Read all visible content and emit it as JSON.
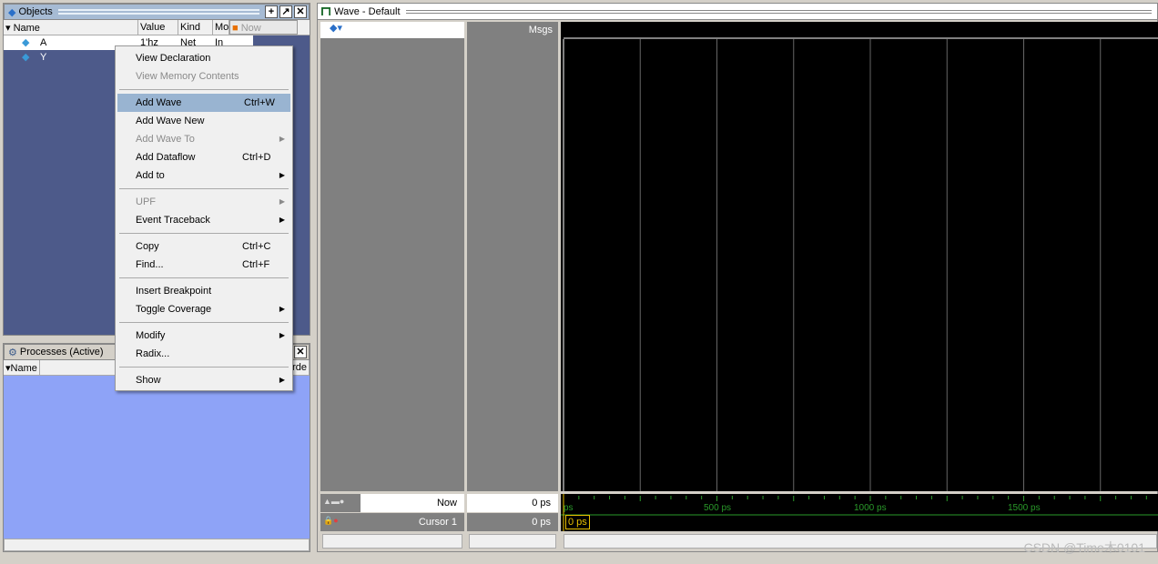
{
  "objects": {
    "title": "Objects",
    "columns": [
      "Name",
      "Value",
      "Kind",
      "Mode"
    ],
    "now_label": "Now",
    "rows": [
      {
        "name": "A",
        "value": "1'hz",
        "kind": "Net",
        "mode": "In"
      },
      {
        "name": "Y",
        "value": "",
        "kind": "",
        "mode": ""
      }
    ]
  },
  "processes": {
    "title": "Processes (Active)",
    "columns": [
      "Name",
      "Orde"
    ]
  },
  "context_menu": [
    {
      "label": "View Declaration",
      "enabled": true
    },
    {
      "label": "View Memory Contents",
      "enabled": false
    },
    {
      "sep": true
    },
    {
      "label": "Add Wave",
      "shortcut": "Ctrl+W",
      "enabled": true,
      "highlighted": true
    },
    {
      "label": "Add Wave New",
      "enabled": true
    },
    {
      "label": "Add Wave To",
      "enabled": false,
      "submenu": true
    },
    {
      "label": "Add Dataflow",
      "shortcut": "Ctrl+D",
      "enabled": true
    },
    {
      "label": "Add to",
      "enabled": true,
      "submenu": true
    },
    {
      "sep": true
    },
    {
      "label": "UPF",
      "enabled": false,
      "submenu": true
    },
    {
      "label": "Event Traceback",
      "enabled": true,
      "submenu": true
    },
    {
      "sep": true
    },
    {
      "label": "Copy",
      "shortcut": "Ctrl+C",
      "enabled": true
    },
    {
      "label": "Find...",
      "shortcut": "Ctrl+F",
      "enabled": true
    },
    {
      "sep": true
    },
    {
      "label": "Insert Breakpoint",
      "enabled": true
    },
    {
      "label": "Toggle Coverage",
      "enabled": true,
      "submenu": true
    },
    {
      "sep": true
    },
    {
      "label": "Modify",
      "enabled": true,
      "submenu": true
    },
    {
      "label": "Radix...",
      "enabled": true
    },
    {
      "sep": true
    },
    {
      "label": "Show",
      "enabled": true,
      "submenu": true
    }
  ],
  "wave": {
    "title": "Wave - Default",
    "msgs_label": "Msgs",
    "now_label": "Now",
    "now_value": "0 ps",
    "cursor_label": "Cursor 1",
    "cursor_value": "0 ps",
    "cursor_time": "0 ps",
    "ticks": [
      "ps",
      "500 ps",
      "1000 ps",
      "1500 ps"
    ]
  },
  "watermark": "CSDN @Time木0101"
}
